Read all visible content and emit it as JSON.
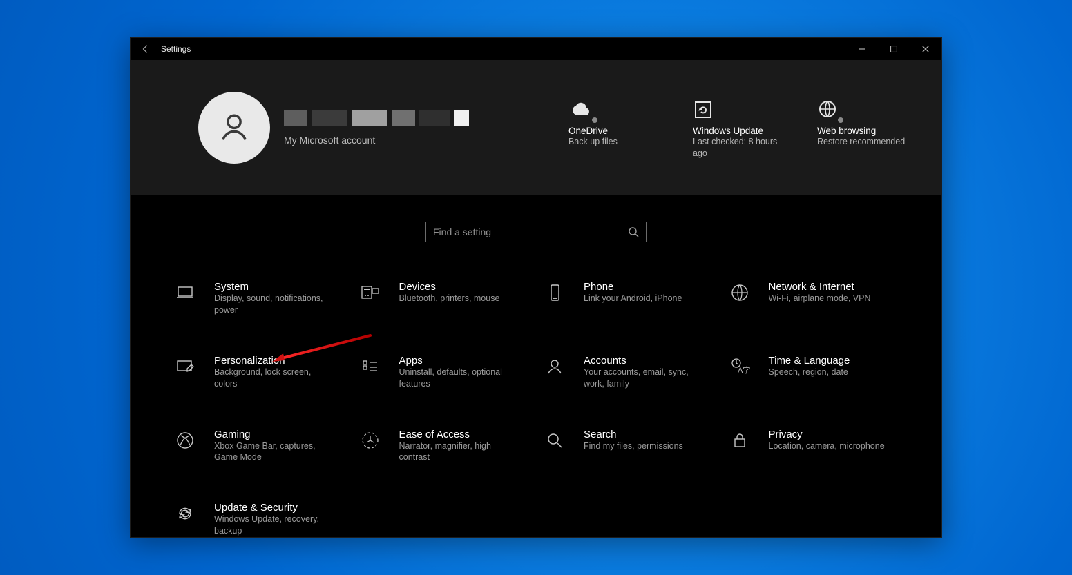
{
  "window": {
    "title": "Settings"
  },
  "header": {
    "account_sub": "My Microsoft account",
    "tiles": [
      {
        "title": "OneDrive",
        "sub": "Back up files"
      },
      {
        "title": "Windows Update",
        "sub": "Last checked: 8 hours ago"
      },
      {
        "title": "Web browsing",
        "sub": "Restore recommended"
      }
    ]
  },
  "search": {
    "placeholder": "Find a setting"
  },
  "categories": [
    {
      "title": "System",
      "desc": "Display, sound, notifications, power"
    },
    {
      "title": "Devices",
      "desc": "Bluetooth, printers, mouse"
    },
    {
      "title": "Phone",
      "desc": "Link your Android, iPhone"
    },
    {
      "title": "Network & Internet",
      "desc": "Wi-Fi, airplane mode, VPN"
    },
    {
      "title": "Personalization",
      "desc": "Background, lock screen, colors"
    },
    {
      "title": "Apps",
      "desc": "Uninstall, defaults, optional features"
    },
    {
      "title": "Accounts",
      "desc": "Your accounts, email, sync, work, family"
    },
    {
      "title": "Time & Language",
      "desc": "Speech, region, date"
    },
    {
      "title": "Gaming",
      "desc": "Xbox Game Bar, captures, Game Mode"
    },
    {
      "title": "Ease of Access",
      "desc": "Narrator, magnifier, high contrast"
    },
    {
      "title": "Search",
      "desc": "Find my files, permissions"
    },
    {
      "title": "Privacy",
      "desc": "Location, camera, microphone"
    },
    {
      "title": "Update & Security",
      "desc": "Windows Update, recovery, backup"
    }
  ],
  "annotation": {
    "target": "Personalization"
  }
}
